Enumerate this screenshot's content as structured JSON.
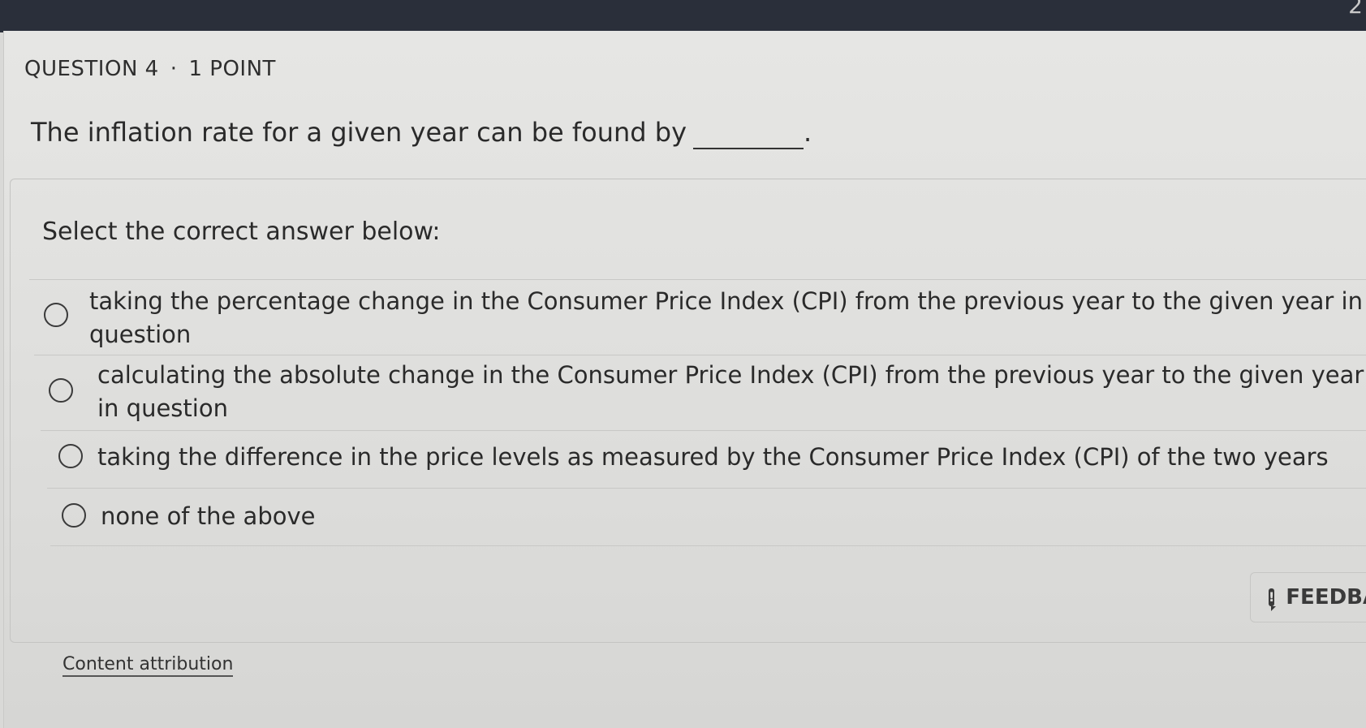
{
  "question": {
    "number_label": "QUESTION 4",
    "separator": "·",
    "points_label": "1 POINT",
    "prompt": "The inflation rate for a given year can be found by",
    "prompt_end": "."
  },
  "answer_section": {
    "instruction": "Select the correct answer below:",
    "options": [
      {
        "label": "taking the percentage change in the Consumer Price Index (CPI) from the previous year to the given year in question"
      },
      {
        "label": "calculating the absolute change in the Consumer Price Index (CPI) from the previous year to the given year in question"
      },
      {
        "label": "taking the difference in the price levels as measured by the Consumer Price Index (CPI) of the two years"
      },
      {
        "label": "none of the above"
      }
    ]
  },
  "feedback_button": {
    "label": "FEEDBACK",
    "icon": "feedback-flag-icon"
  },
  "footer": {
    "attribution_link": "Content attribution"
  },
  "topbar": {
    "corner_text": "2"
  }
}
